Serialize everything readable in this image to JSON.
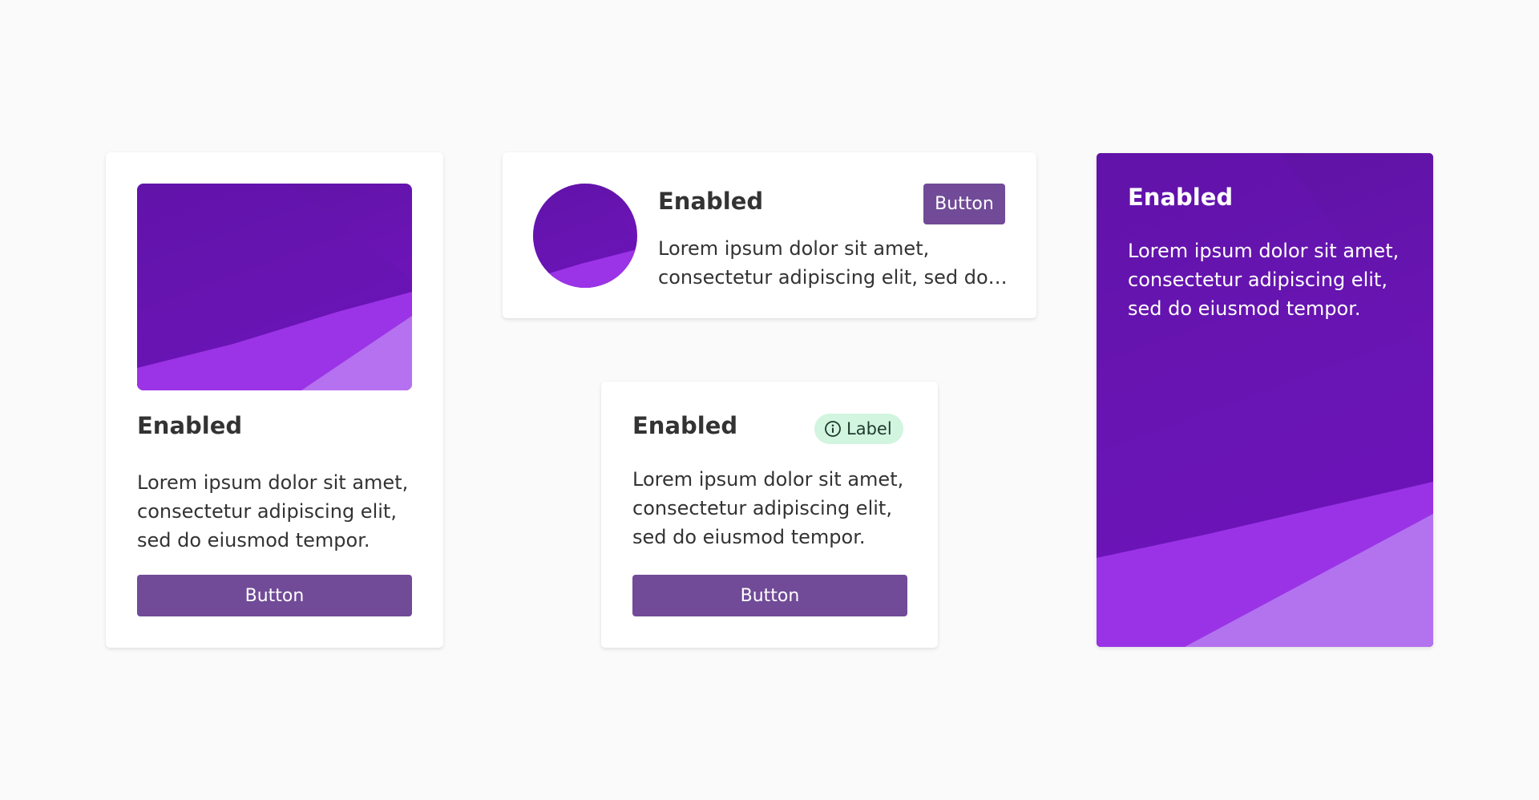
{
  "colors": {
    "background": "#fafafa",
    "card": "#ffffff",
    "button": "#714b97",
    "button_text": "#ffffff",
    "text": "#333333",
    "badge_bg": "#d2f5e0",
    "art_dark": "#5c13a0",
    "art_mid": "#7512c6",
    "art_light": "#a13be8"
  },
  "card_vertical": {
    "title": "Enabled",
    "body": "Lorem ipsum dolor sit amet, consectetur adipiscing elit, sed do eiusmod tempor.",
    "button_label": "Button"
  },
  "card_horizontal": {
    "title": "Enabled",
    "button_label": "Button",
    "body_line1": "Lorem ipsum dolor sit amet,",
    "body_line2": "consectetur adipiscing elit, sed do eiusmod tempor."
  },
  "card_label": {
    "title": "Enabled",
    "badge": {
      "icon": "info-icon",
      "label": "Label"
    },
    "body": "Lorem ipsum dolor sit amet, consectetur adipiscing elit, sed do eiusmod tempor.",
    "button_label": "Button"
  },
  "card_full": {
    "title": "Enabled",
    "body": "Lorem ipsum dolor sit amet, consectetur adipiscing elit, sed do eiusmod tempor."
  }
}
